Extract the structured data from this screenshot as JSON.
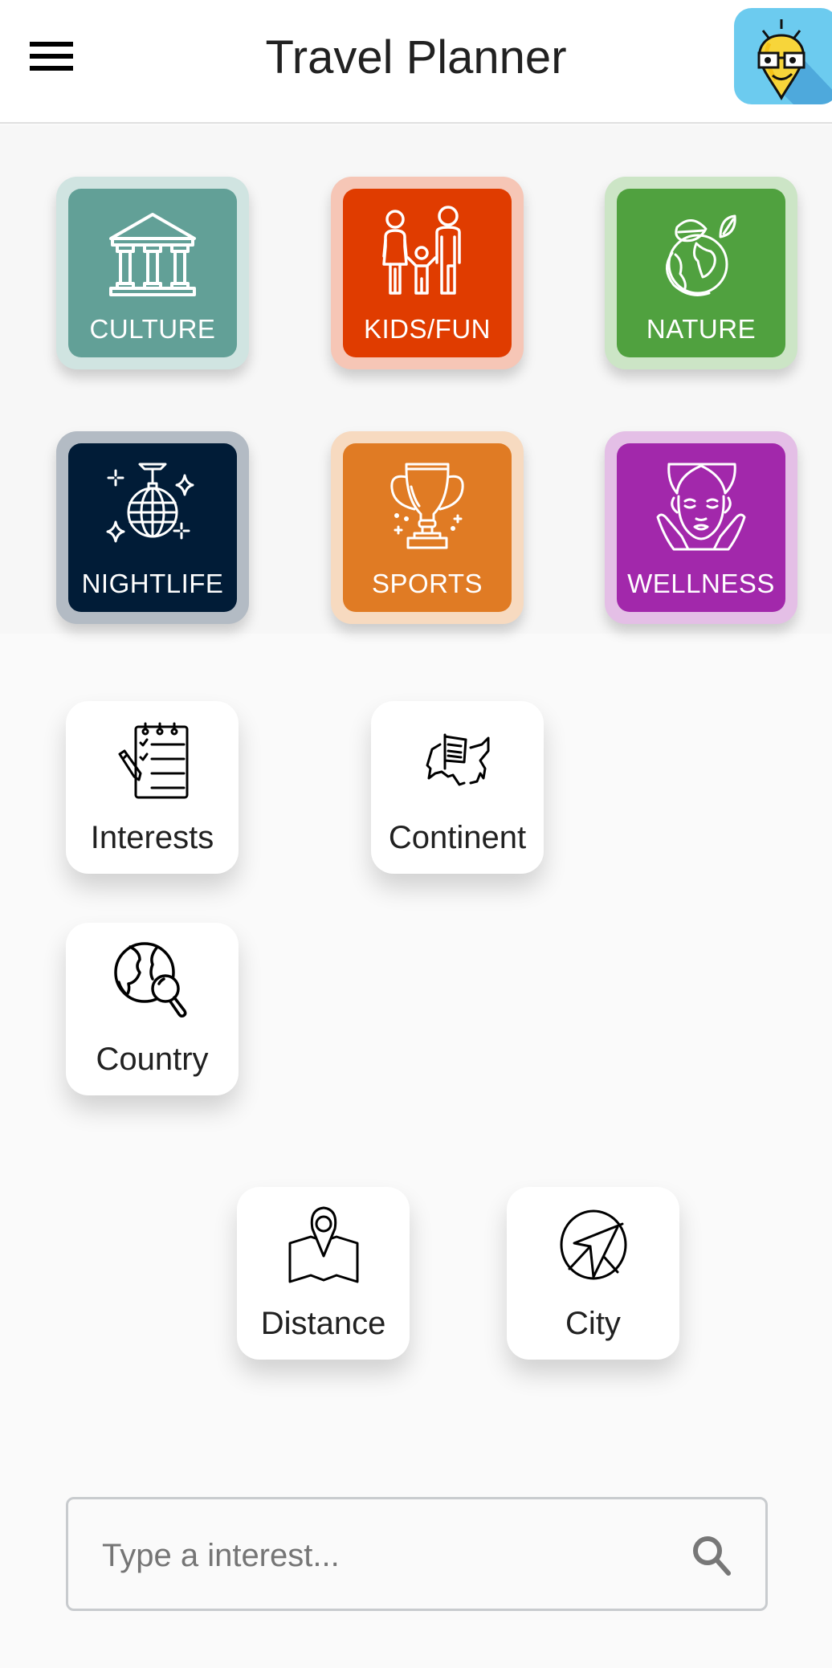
{
  "header": {
    "title": "Travel Planner",
    "menu_icon": "hamburger-menu-icon",
    "logo_icon": "nerd-lightbulb-pin-logo"
  },
  "categories": [
    {
      "label": "CULTURE",
      "icon": "temple-columns-icon",
      "color": "#62a097",
      "frame": "#d0e4e1"
    },
    {
      "label": "KIDS/FUN",
      "icon": "family-icon",
      "color": "#e03c00",
      "frame": "#f6c6b6"
    },
    {
      "label": "NATURE",
      "icon": "earth-leaves-icon",
      "color": "#50a13f",
      "frame": "#cce5c6"
    },
    {
      "label": "NIGHTLIFE",
      "icon": "disco-ball-icon",
      "color": "#011c37",
      "frame": "#b3bbc4"
    },
    {
      "label": "SPORTS",
      "icon": "trophy-icon",
      "color": "#e07b24",
      "frame": "#f7dac0"
    },
    {
      "label": "WELLNESS",
      "icon": "spa-face-icon",
      "color": "#a228ab",
      "frame": "#e4bfe6"
    }
  ],
  "filters": [
    {
      "label": "Interests",
      "icon": "checklist-notepad-icon"
    },
    {
      "label": "Continent",
      "icon": "map-flag-icon"
    },
    {
      "label": "Country",
      "icon": "globe-search-icon"
    },
    {
      "label": "Distance",
      "icon": "map-pin-icon"
    },
    {
      "label": "City",
      "icon": "compass-arrow-icon"
    }
  ],
  "search": {
    "placeholder": "Type a interest...",
    "value": "",
    "icon": "search-icon"
  }
}
